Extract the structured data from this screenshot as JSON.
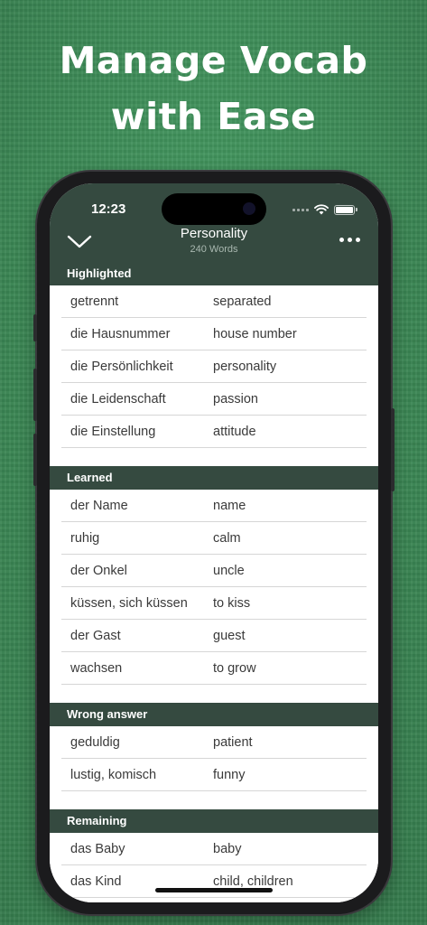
{
  "promo": {
    "headline_line1": "Manage Vocab",
    "headline_line2": "with Ease"
  },
  "status_bar": {
    "time": "12:23"
  },
  "nav": {
    "title": "Personality",
    "subtitle": "240 Words"
  },
  "sections": [
    {
      "title": "Highlighted",
      "rows": [
        {
          "de": "getrennt",
          "en": "separated"
        },
        {
          "de": "die Hausnummer",
          "en": "house number"
        },
        {
          "de": "die Persönlichkeit",
          "en": "personality"
        },
        {
          "de": "die Leidenschaft",
          "en": "passion"
        },
        {
          "de": "die Einstellung",
          "en": "attitude"
        }
      ]
    },
    {
      "title": "Learned",
      "rows": [
        {
          "de": "der Name",
          "en": "name"
        },
        {
          "de": "ruhig",
          "en": "calm"
        },
        {
          "de": "der Onkel",
          "en": "uncle"
        },
        {
          "de": "küssen, sich küssen",
          "en": "to kiss"
        },
        {
          "de": "der Gast",
          "en": "guest"
        },
        {
          "de": "wachsen",
          "en": "to grow"
        }
      ]
    },
    {
      "title": "Wrong answer",
      "rows": [
        {
          "de": "geduldig",
          "en": "patient"
        },
        {
          "de": "lustig, komisch",
          "en": "funny"
        }
      ]
    },
    {
      "title": "Remaining",
      "rows": [
        {
          "de": "das Baby",
          "en": "baby"
        },
        {
          "de": "das Kind",
          "en": "child, children"
        }
      ]
    }
  ],
  "colors": {
    "background_green": "#3f8f59",
    "header_dark_green": "#354a40",
    "phone_frame": "#1b1b1d"
  },
  "icons": {
    "back": "chevron-down-icon",
    "more": "ellipsis-icon",
    "wifi": "wifi-icon",
    "battery": "battery-icon"
  }
}
